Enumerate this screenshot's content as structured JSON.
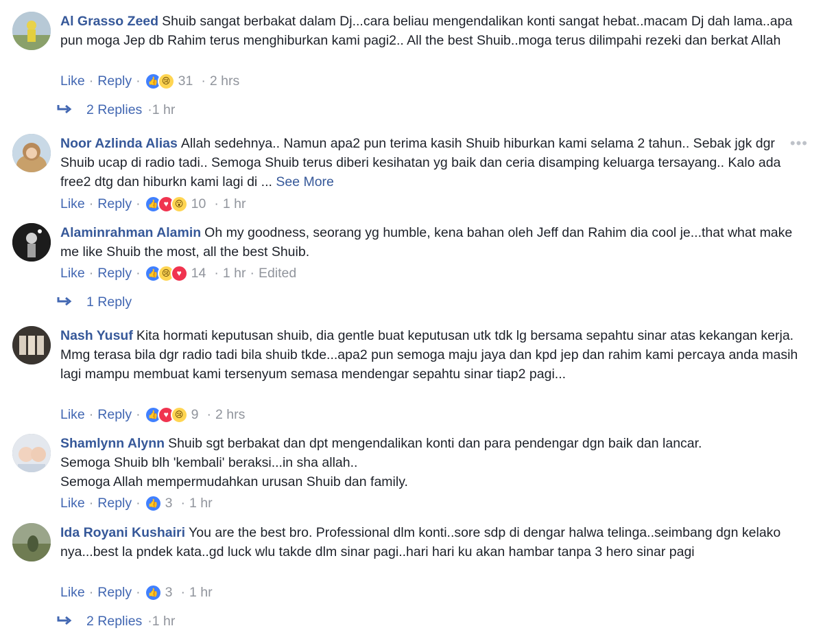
{
  "ui": {
    "like": "Like",
    "reply": "Reply",
    "dot": "·",
    "see_more": "See More"
  },
  "colors": {
    "link": "#365899",
    "action": "#4267b2",
    "meta": "#90949c",
    "like": "#4080ff",
    "love": "#f0344f",
    "wow": "#ffd552"
  },
  "comments": [
    {
      "author": "Al Grasso Zeed",
      "text": "Shuib sangat berbakat dalam Dj...cara beliau mengendalikan konti sangat hebat..macam Dj dah lama..apa pun moga Jep db Rahim terus menghiburkan kami pagi2.. All the best Shuib..moga terus dilimpahi rezeki dan berkat Allah",
      "reactions": [
        "like-icon",
        "sad-icon"
      ],
      "count": "31",
      "time": "2 hrs",
      "replies": {
        "label": "2 Replies",
        "time": "1 hr"
      }
    },
    {
      "author": "Noor Azlinda Alias",
      "text": "Allah sedehnya.. Namun apa2 pun terima kasih Shuib hiburkan kami selama 2 tahun.. Sebak jgk dgr Shuib ucap di radio tadi.. Semoga Shuib terus diberi kesihatan yg baik dan ceria disamping keluarga tersayang.. Kalo ada free2 dtg dan hiburkn kami lagi di ...",
      "see_more": "See More",
      "reactions": [
        "like-icon",
        "love-icon",
        "wow-icon"
      ],
      "count": "10",
      "time": "1 hr"
    },
    {
      "author": "Alaminrahman Alamin",
      "text": "Oh my goodness, seorang yg humble, kena bahan oleh Jeff dan Rahim dia cool je...that what make me like Shuib the most, all the best Shuib.",
      "reactions": [
        "like-icon",
        "sad-icon",
        "love-icon"
      ],
      "count": "14",
      "time": "1 hr",
      "edited": "Edited",
      "replies": {
        "label": "1 Reply"
      }
    },
    {
      "author": "Nash Yusuf",
      "text": "Kita hormati keputusan shuib, dia gentle buat keputusan utk tdk lg bersama sepahtu sinar atas kekangan kerja. Mmg terasa bila dgr radio tadi bila shuib tkde...apa2 pun semoga maju jaya dan kpd jep dan rahim kami percaya anda masih lagi mampu membuat kami tersenyum semasa mendengar sepahtu sinar tiap2 pagi...",
      "reactions": [
        "like-icon",
        "love-icon",
        "sad-icon"
      ],
      "count": "9",
      "time": "2 hrs"
    },
    {
      "author": "Shamlynn Alynn",
      "text_lines": [
        "Shuib sgt berbakat dan dpt mengendalikan konti dan para pendengar dgn baik dan lancar.",
        "Semoga Shuib blh 'kembali' beraksi...in sha allah..",
        "Semoga Allah mempermudahkan urusan Shuib dan family."
      ],
      "reactions": [
        "like-icon"
      ],
      "count": "3",
      "time": "1 hr"
    },
    {
      "author": "Ida Royani Kushairi",
      "text": "You are the best bro. Professional dlm konti..sore sdp di dengar halwa telinga..seimbang dgn kelako nya...best la pndek kata..gd luck wlu takde dlm sinar pagi..hari hari ku akan hambar tanpa 3 hero sinar pagi",
      "reactions": [
        "like-icon"
      ],
      "count": "3",
      "time": "1 hr",
      "replies": {
        "label": "2 Replies",
        "time": "1 hr"
      }
    }
  ]
}
